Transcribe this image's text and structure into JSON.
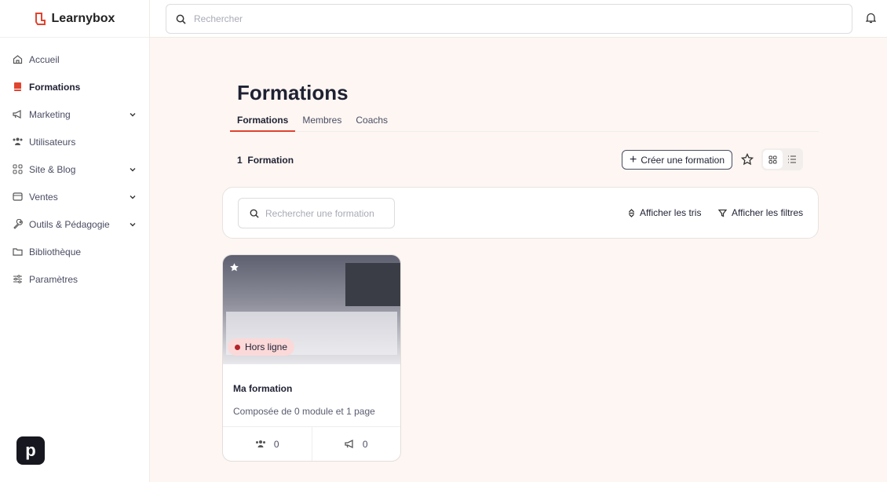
{
  "app": {
    "name": "Learnybox",
    "brand_color": "#e0442f"
  },
  "sidebar": {
    "items": [
      {
        "label": "Accueil",
        "icon": "home-icon"
      },
      {
        "label": "Formations",
        "icon": "book-icon",
        "active": true
      },
      {
        "label": "Marketing",
        "icon": "megaphone-icon",
        "chevron": true
      },
      {
        "label": "Utilisateurs",
        "icon": "users-icon"
      },
      {
        "label": "Site & Blog",
        "icon": "grid-icon",
        "chevron": true
      },
      {
        "label": "Ventes",
        "icon": "wallet-icon",
        "chevron": true
      },
      {
        "label": "Outils & Pédagogie",
        "icon": "wrench-icon",
        "chevron": true
      },
      {
        "label": "Bibliothèque",
        "icon": "folder-icon"
      },
      {
        "label": "Paramètres",
        "icon": "sliders-icon"
      }
    ],
    "bottom_button": "p"
  },
  "topbar": {
    "search_placeholder": "Rechercher"
  },
  "page": {
    "title": "Formations",
    "tabs": [
      {
        "label": "Formations",
        "active": true
      },
      {
        "label": "Membres"
      },
      {
        "label": "Coachs"
      }
    ],
    "count_num": "1",
    "count_label": "Formation",
    "create_label": "Créer une formation",
    "filter_placeholder": "Rechercher une formation",
    "sort_label": "Afficher les tris",
    "filter_label": "Afficher les filtres",
    "view_mode": "grid"
  },
  "cards": [
    {
      "title": "Ma formation",
      "status": "Hors ligne",
      "status_color": "#b3232a",
      "description": "Composée de 0 module et 1 page",
      "members": "0",
      "campaigns": "0"
    }
  ]
}
